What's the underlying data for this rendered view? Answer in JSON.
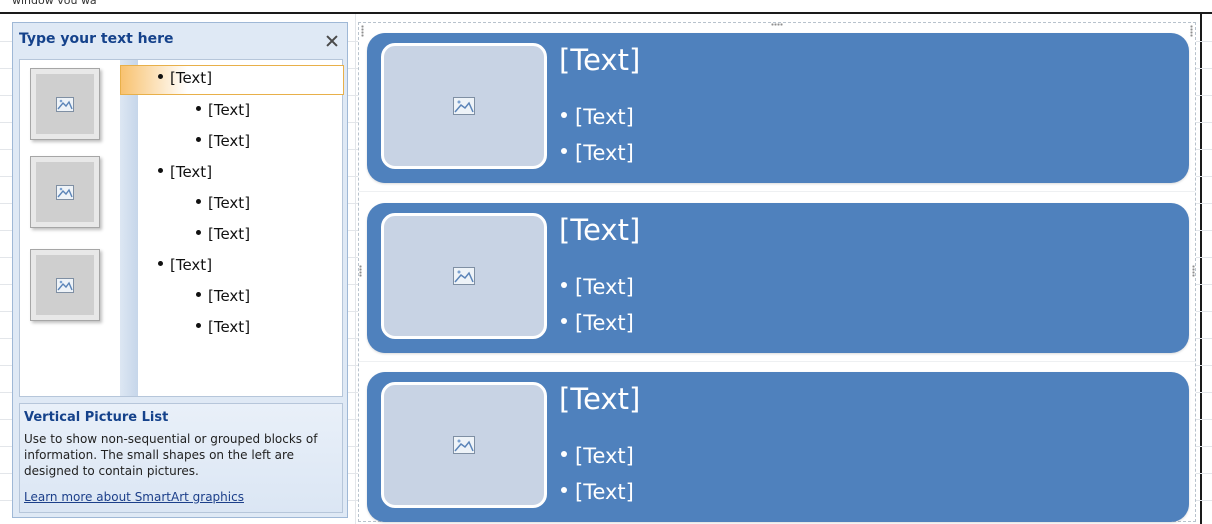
{
  "text_pane": {
    "title": "Type your text here",
    "items": [
      {
        "level": 1,
        "text": "[Text]"
      },
      {
        "level": 2,
        "text": "[Text]"
      },
      {
        "level": 2,
        "text": "[Text]"
      },
      {
        "level": 1,
        "text": "[Text]"
      },
      {
        "level": 2,
        "text": "[Text]"
      },
      {
        "level": 2,
        "text": "[Text]"
      },
      {
        "level": 1,
        "text": "[Text]"
      },
      {
        "level": 2,
        "text": "[Text]"
      },
      {
        "level": 2,
        "text": "[Text]"
      }
    ],
    "info": {
      "title": "Vertical Picture List",
      "description": "Use to show non-sequential or grouped blocks of information. The small shapes on the left are designed to contain pictures.",
      "link": "Learn more about SmartArt graphics"
    }
  },
  "diagram": {
    "blocks": [
      {
        "title": "[Text]",
        "bullets": [
          "[Text]",
          "[Text]"
        ]
      },
      {
        "title": "[Text]",
        "bullets": [
          "[Text]",
          "[Text]"
        ]
      },
      {
        "title": "[Text]",
        "bullets": [
          "[Text]",
          "[Text]"
        ]
      }
    ]
  },
  "colors": {
    "block_fill": "#4f81bd",
    "picture_placeholder": "#c8d3e4",
    "pane_title": "#15428b",
    "selection_highlight": "#f8c270"
  },
  "icons": {
    "picture_placeholder": "picture-icon",
    "close": "close-icon"
  }
}
